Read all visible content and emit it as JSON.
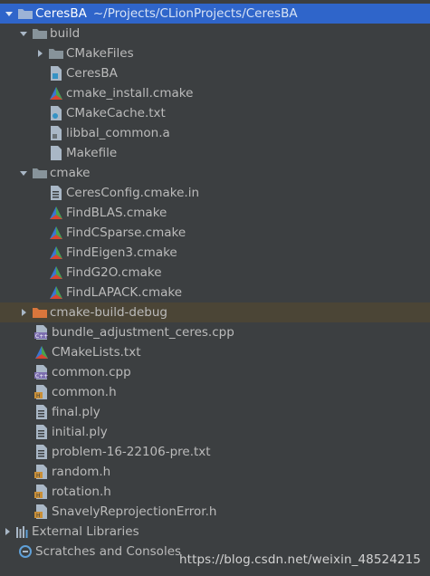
{
  "project": {
    "name": "CeresBA",
    "path": "~/Projects/CLionProjects/CeresBA"
  },
  "tree": {
    "build": {
      "label": "build",
      "cmakefiles": "CMakeFiles",
      "ceresba": "CeresBA",
      "cmake_install": "cmake_install.cmake",
      "cmakecache": "CMakeCache.txt",
      "libbal_common": "libbal_common.a",
      "makefile": "Makefile"
    },
    "cmake": {
      "label": "cmake",
      "ceresconfig": "CeresConfig.cmake.in",
      "findblas": "FindBLAS.cmake",
      "findcsparse": "FindCSparse.cmake",
      "findeigen3": "FindEigen3.cmake",
      "findg2o": "FindG2O.cmake",
      "findlapack": "FindLAPACK.cmake"
    },
    "cmake_build_debug": "cmake-build-debug",
    "files": {
      "bundle_adjustment": "bundle_adjustment_ceres.cpp",
      "cmakelists": "CMakeLists.txt",
      "common_cpp": "common.cpp",
      "common_h": "common.h",
      "final_ply": "final.ply",
      "initial_ply": "initial.ply",
      "problem_txt": "problem-16-22106-pre.txt",
      "random_h": "random.h",
      "rotation_h": "rotation.h",
      "snavely_h": "SnavelyReprojectionError.h"
    },
    "external_libraries": "External Libraries",
    "scratches": "Scratches and Consoles"
  },
  "watermark": "https://blog.csdn.net/weixin_48524215",
  "colors": {
    "panel_bg": "#3c3f41",
    "selection": "#2f65ca",
    "excluded_bg": "#4b4536",
    "folder": "#87939a",
    "excluded_folder": "#d9763c",
    "text": "#bbbbbb"
  },
  "icons": {
    "folder": "folder-icon",
    "cmake": "cmake-triangle-icon",
    "cpp": "cpp-file-icon",
    "header": "header-file-icon",
    "text": "text-file-icon",
    "binary": "binary-file-icon",
    "libraries": "library-bars-icon",
    "scratches": "scratches-icon"
  }
}
